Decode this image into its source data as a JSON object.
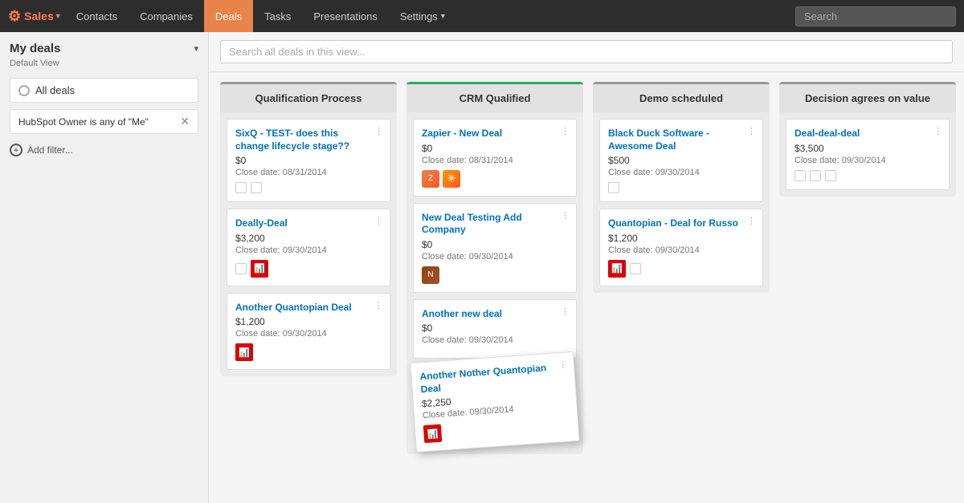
{
  "nav": {
    "brand": "Sales",
    "brand_caret": "▾",
    "items": [
      {
        "label": "Contacts",
        "active": false
      },
      {
        "label": "Companies",
        "active": false
      },
      {
        "label": "Deals",
        "active": true
      },
      {
        "label": "Tasks",
        "active": false
      },
      {
        "label": "Presentations",
        "active": false
      },
      {
        "label": "Settings",
        "active": false,
        "caret": "▾"
      }
    ],
    "search_placeholder": "Search"
  },
  "sidebar": {
    "title": "My deals",
    "subtitle": "Default View",
    "all_deals_label": "All deals",
    "filter_label": "HubSpot Owner is any of \"Me\"",
    "add_filter_label": "Add filter..."
  },
  "board": {
    "search_placeholder": "Search all deals in this view...",
    "columns": [
      {
        "id": "qualification",
        "header": "Qualification Process",
        "cards": [
          {
            "name": "SixQ - TEST- does this change lifecycle stage??",
            "amount": "$0",
            "close_date": "Close date: 08/31/2014",
            "avatars": [],
            "has_checkboxes": true,
            "has_chart": false
          },
          {
            "name": "Deally-Deal",
            "amount": "$3,200",
            "close_date": "Close date: 09/30/2014",
            "avatars": [],
            "has_checkboxes": true,
            "has_chart": true
          },
          {
            "name": "Another Quantopian Deal",
            "amount": "$1,200",
            "close_date": "Close date: 09/30/2014",
            "avatars": [],
            "has_checkboxes": false,
            "has_chart": true
          }
        ]
      },
      {
        "id": "crm",
        "header": "CRM Qualified",
        "cards": [
          {
            "name": "Zapier - New Deal",
            "amount": "$0",
            "close_date": "Close date: 08/31/2014",
            "avatars": [
              "orange",
              "burst"
            ],
            "has_checkboxes": false,
            "has_chart": false
          },
          {
            "name": "New Deal Testing Add Company",
            "amount": "$0",
            "close_date": "Close date: 09/30/2014",
            "avatars": [
              "brown"
            ],
            "has_checkboxes": false,
            "has_chart": false
          },
          {
            "name": "Another new deal",
            "amount": "$0",
            "close_date": "Close date: 09/30/2014",
            "avatars": [],
            "has_checkboxes": false,
            "has_chart": false
          }
        ]
      },
      {
        "id": "demo",
        "header": "Demo scheduled",
        "cards": [
          {
            "name": "Black Duck Software - Awesome Deal",
            "amount": "$500",
            "close_date": "Close date: 09/30/2014",
            "avatars": [],
            "has_checkboxes": true,
            "has_chart": false
          },
          {
            "name": "Quantopian - Deal for Russo",
            "amount": "$1,200",
            "close_date": "Close date: 09/30/2014",
            "avatars": [],
            "has_checkboxes": true,
            "has_chart": true
          }
        ]
      },
      {
        "id": "decision",
        "header": "Decision agrees on value",
        "cards": [
          {
            "name": "Deal-deal-deal",
            "amount": "$3,500",
            "close_date": "Close date: 09/30/2014",
            "avatars": [],
            "has_checkboxes": true,
            "has_chart": false
          }
        ]
      }
    ]
  },
  "dragging_card": {
    "name": "Another Nother Quantopian Deal",
    "amount": "$2,250",
    "close_date": "Close date: 09/30/2014",
    "has_chart": true
  }
}
